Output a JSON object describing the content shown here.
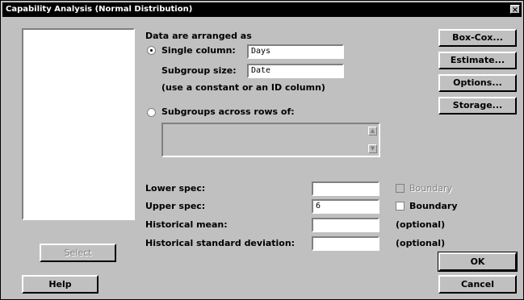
{
  "window": {
    "title": "Capability Analysis (Normal Distribution)",
    "close_glyph": "×"
  },
  "data_arranged_label": "Data are arranged as",
  "single_column": {
    "label": "Single column:",
    "value": "Days",
    "selected": true
  },
  "subgroup_size": {
    "label": "Subgroup size:",
    "value": "Date"
  },
  "constant_note": "(use a constant or an ID column)",
  "subgroups_across": {
    "label": "Subgroups across rows of:",
    "selected": false
  },
  "lower_spec": {
    "label": "Lower spec:",
    "value": "",
    "boundary_label": "Boundary",
    "boundary_enabled": false
  },
  "upper_spec": {
    "label": "Upper spec:",
    "value": "6",
    "boundary_label": "Boundary",
    "boundary_enabled": true
  },
  "historical_mean": {
    "label": "Historical mean:",
    "value": "",
    "note": "(optional)"
  },
  "historical_sd": {
    "label": "Historical standard deviation:",
    "value": "",
    "note": "(optional)"
  },
  "buttons": {
    "box_cox": "Box-Cox...",
    "estimate": "Estimate...",
    "options": "Options...",
    "storage": "Storage...",
    "select": "Select",
    "help": "Help",
    "ok": "OK",
    "cancel": "Cancel"
  },
  "icons": {
    "scroll_up": "▲",
    "scroll_down": "▼"
  }
}
